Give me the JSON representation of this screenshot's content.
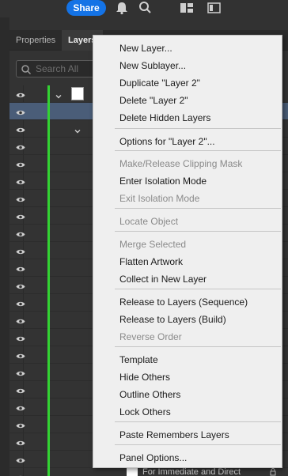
{
  "topbar": {
    "share_label": "Share"
  },
  "panel": {
    "tabs": [
      {
        "label": "Properties"
      },
      {
        "label": "Layers"
      }
    ],
    "search_placeholder": "Search All",
    "bottom_layer_name": "For Immediate and Direct"
  },
  "colors": {
    "accent": "#1473e6",
    "layer_color": "#33d333",
    "selected_row": "#4a5d78"
  },
  "context_menu": {
    "items": [
      {
        "label": "New Layer...",
        "enabled": true
      },
      {
        "label": "New Sublayer...",
        "enabled": true
      },
      {
        "label": "Duplicate \"Layer 2\"",
        "enabled": true
      },
      {
        "label": "Delete \"Layer 2\"",
        "enabled": true
      },
      {
        "label": "Delete Hidden Layers",
        "enabled": true
      },
      {
        "label": "Options for \"Layer 2\"...",
        "enabled": true
      },
      {
        "label": "Make/Release Clipping Mask",
        "enabled": false
      },
      {
        "label": "Enter Isolation Mode",
        "enabled": true
      },
      {
        "label": "Exit Isolation Mode",
        "enabled": false
      },
      {
        "label": "Locate Object",
        "enabled": false
      },
      {
        "label": "Merge Selected",
        "enabled": false
      },
      {
        "label": "Flatten Artwork",
        "enabled": true
      },
      {
        "label": "Collect in New Layer",
        "enabled": true
      },
      {
        "label": "Release to Layers (Sequence)",
        "enabled": true
      },
      {
        "label": "Release to Layers (Build)",
        "enabled": true
      },
      {
        "label": "Reverse Order",
        "enabled": false
      },
      {
        "label": "Template",
        "enabled": true
      },
      {
        "label": "Hide Others",
        "enabled": true
      },
      {
        "label": "Outline Others",
        "enabled": true
      },
      {
        "label": "Lock Others",
        "enabled": true
      },
      {
        "label": "Paste Remembers Layers",
        "enabled": true
      },
      {
        "label": "Panel Options...",
        "enabled": true
      }
    ]
  },
  "icons": [
    "bell-icon",
    "search-icon",
    "workspace-icon",
    "panel-toggle-icon",
    "eye-icon",
    "chevron-down-icon",
    "lock-icon"
  ]
}
